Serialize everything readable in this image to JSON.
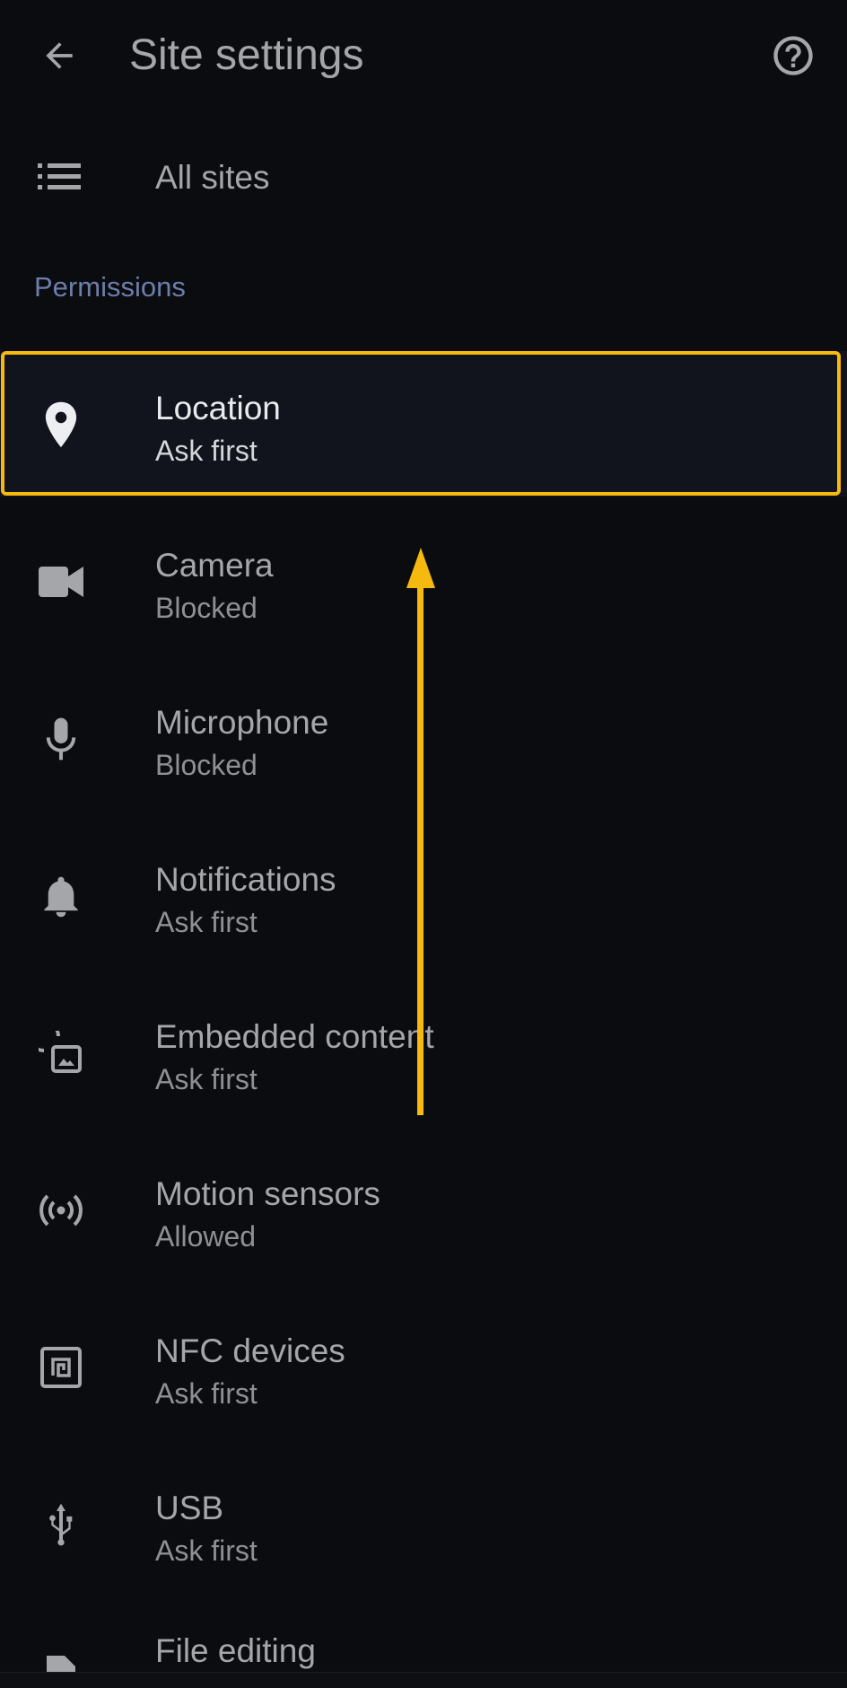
{
  "app_bar": {
    "title": "Site settings",
    "back_icon": "arrow-left-icon",
    "help_icon": "help-circle-icon"
  },
  "all_sites": {
    "label": "All sites",
    "icon": "list-icon"
  },
  "permissions": {
    "header": "Permissions",
    "items": [
      {
        "title": "Location",
        "status": "Ask first",
        "icon": "location-pin-icon"
      },
      {
        "title": "Camera",
        "status": "Blocked",
        "icon": "video-camera-icon"
      },
      {
        "title": "Microphone",
        "status": "Blocked",
        "icon": "microphone-icon"
      },
      {
        "title": "Notifications",
        "status": "Ask first",
        "icon": "bell-icon"
      },
      {
        "title": "Embedded content",
        "status": "Ask first",
        "icon": "embedded-content-icon"
      },
      {
        "title": "Motion sensors",
        "status": "Allowed",
        "icon": "sensors-icon"
      },
      {
        "title": "NFC devices",
        "status": "Ask first",
        "icon": "nfc-icon"
      },
      {
        "title": "USB",
        "status": "Ask first",
        "icon": "usb-icon"
      },
      {
        "title": "File editing",
        "status": "",
        "icon": "file-edit-icon"
      }
    ]
  },
  "colors": {
    "background": "#0b0c10",
    "highlight_border": "#f6b90f",
    "section_header": "#6c7ea9",
    "selected_row": "#11131d"
  }
}
